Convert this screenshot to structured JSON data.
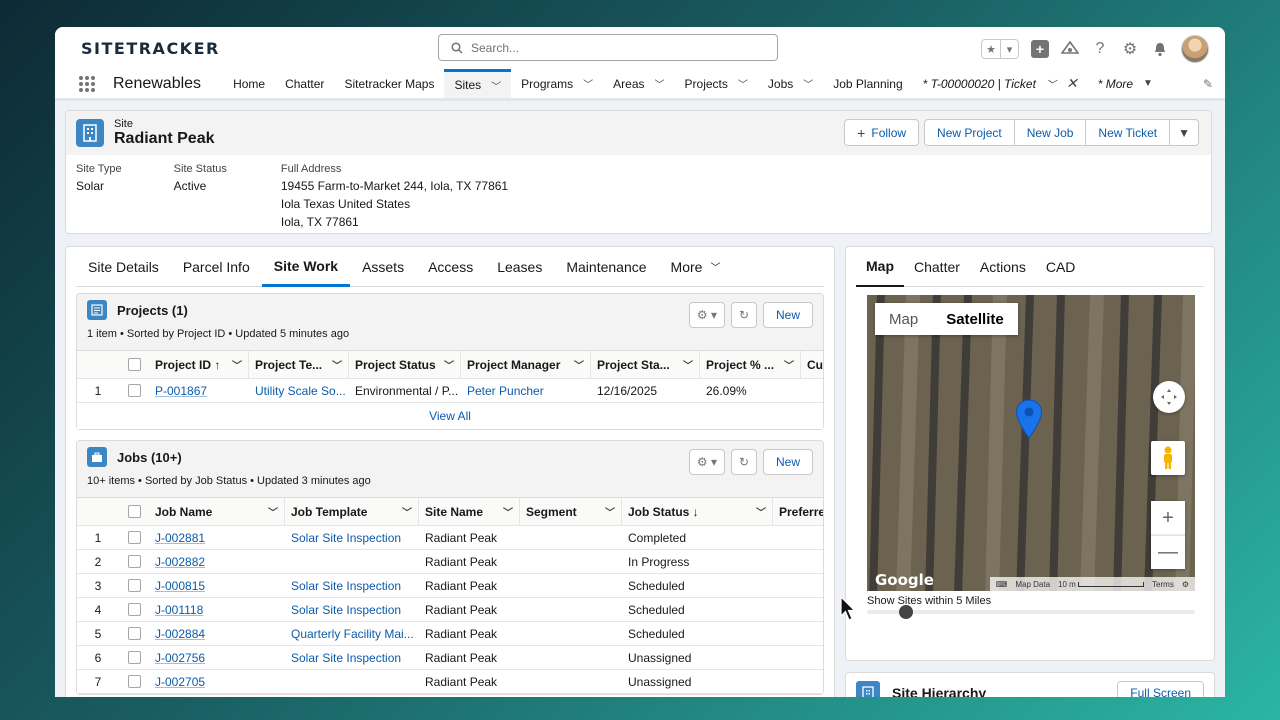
{
  "header": {
    "logo": "SITETRACKER",
    "search_placeholder": "Search..."
  },
  "nav": {
    "app_name": "Renewables",
    "items": [
      {
        "label": "Home",
        "chev": false
      },
      {
        "label": "Chatter",
        "chev": false
      },
      {
        "label": "Sitetracker Maps",
        "chev": false
      },
      {
        "label": "Sites",
        "chev": true,
        "active": true
      },
      {
        "label": "Programs",
        "chev": true
      },
      {
        "label": "Areas",
        "chev": true
      },
      {
        "label": "Projects",
        "chev": true
      },
      {
        "label": "Jobs",
        "chev": true
      },
      {
        "label": "Job Planning",
        "chev": false
      },
      {
        "label": "* T-00000020 | Ticket",
        "chev": true,
        "close": true,
        "italic": true
      },
      {
        "label": "* More",
        "chev": true,
        "italic": true
      }
    ]
  },
  "record": {
    "type_label": "Site",
    "name": "Radiant Peak",
    "actions": {
      "follow": "Follow",
      "new_project": "New Project",
      "new_job": "New Job",
      "new_ticket": "New Ticket"
    },
    "fields": {
      "site_type_label": "Site Type",
      "site_type": "Solar",
      "site_status_label": "Site Status",
      "site_status": "Active",
      "address_label": "Full Address",
      "address_line1": "19455 Farm-to-Market 244, Iola, TX 77861",
      "address_line2": "Iola Texas United States",
      "address_line3": "Iola, TX 77861"
    }
  },
  "tabs": [
    "Site Details",
    "Parcel Info",
    "Site Work",
    "Assets",
    "Access",
    "Leases",
    "Maintenance",
    "More"
  ],
  "active_tab": "Site Work",
  "projects": {
    "title": "Projects (1)",
    "subtitle": "1 item • Sorted by Project ID • Updated 5 minutes ago",
    "new_label": "New",
    "columns": [
      "Project ID ↑",
      "Project Te...",
      "Project Status",
      "Project Manager",
      "Project Sta...",
      "Project % ...",
      "Cu"
    ],
    "rows": [
      {
        "n": "1",
        "id": "P-001867",
        "template": "Utility Scale So...",
        "status": "Environmental / P...",
        "manager": "Peter Puncher",
        "start": "12/16/2025",
        "pct": "26.09%"
      }
    ],
    "view_all": "View All"
  },
  "jobs": {
    "title": "Jobs (10+)",
    "subtitle": "10+ items • Sorted by Job Status • Updated 3 minutes ago",
    "new_label": "New",
    "columns": [
      "Job Name",
      "Job Template",
      "Site Name",
      "Segment",
      "Job Status ↓",
      "Preferre"
    ],
    "rows": [
      {
        "n": "1",
        "name": "J-002881",
        "template": "Solar Site Inspection",
        "site": "Radiant Peak",
        "segment": "",
        "status": "Completed"
      },
      {
        "n": "2",
        "name": "J-002882",
        "template": "",
        "site": "Radiant Peak",
        "segment": "",
        "status": "In Progress"
      },
      {
        "n": "3",
        "name": "J-000815",
        "template": "Solar Site Inspection",
        "site": "Radiant Peak",
        "segment": "",
        "status": "Scheduled"
      },
      {
        "n": "4",
        "name": "J-001118",
        "template": "Solar Site Inspection",
        "site": "Radiant Peak",
        "segment": "",
        "status": "Scheduled"
      },
      {
        "n": "5",
        "name": "J-002884",
        "template": "Quarterly Facility Mai...",
        "site": "Radiant Peak",
        "segment": "",
        "status": "Scheduled"
      },
      {
        "n": "6",
        "name": "J-002756",
        "template": "Solar Site Inspection",
        "site": "Radiant Peak",
        "segment": "",
        "status": "Unassigned"
      },
      {
        "n": "7",
        "name": "J-002705",
        "template": "",
        "site": "Radiant Peak",
        "segment": "",
        "status": "Unassigned"
      }
    ]
  },
  "map_panel": {
    "tabs": [
      "Map",
      "Chatter",
      "Actions",
      "CAD"
    ],
    "active_tab": "Map",
    "map_type_options": [
      "Map",
      "Satellite"
    ],
    "map_type_selected": "Satellite",
    "google_label": "Google",
    "map_data_label": "Map Data",
    "scale_label": "10 m",
    "terms_label": "Terms",
    "radius_label": "Show Sites within 5 Miles",
    "radius_slider_fraction": 0.12
  },
  "hierarchy": {
    "title": "Site Hierarchy",
    "fullscreen_label": "Full Screen"
  },
  "colors": {
    "brand_blue": "#0176d3",
    "link": "#0b5cab",
    "pin": "#1a73e8"
  }
}
